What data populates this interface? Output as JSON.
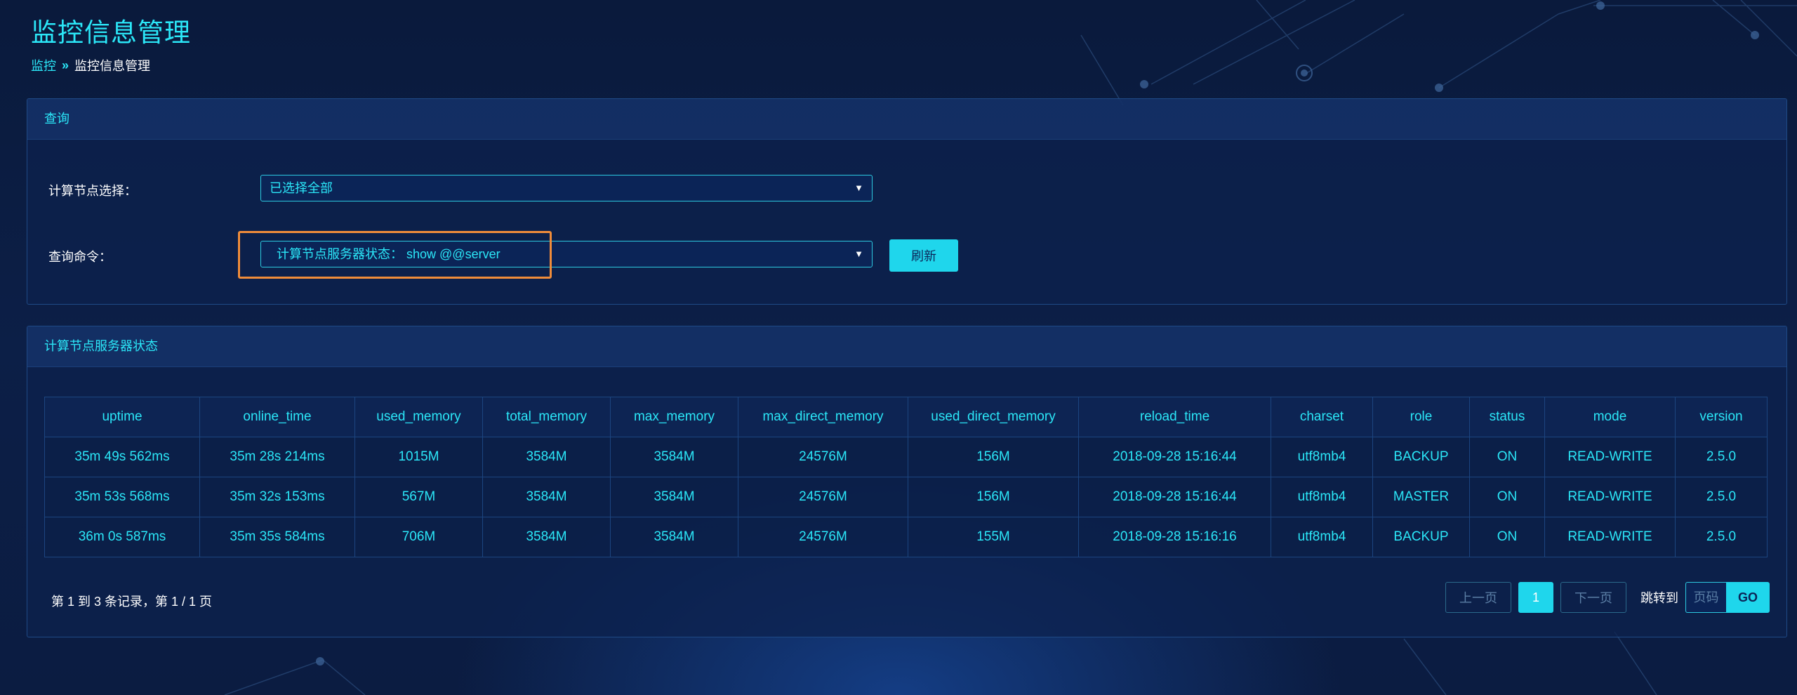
{
  "page": {
    "title": "监控信息管理"
  },
  "breadcrumb": {
    "root": "监控",
    "separator": "»",
    "current": "监控信息管理"
  },
  "query_panel": {
    "title": "查询",
    "node_label": "计算节点选择：",
    "node_value": "已选择全部",
    "command_label": "查询命令：",
    "command_value": "计算节点服务器状态：  show @@server",
    "refresh_label": "刷新"
  },
  "status_panel": {
    "title": "计算节点服务器状态",
    "columns": [
      "uptime",
      "online_time",
      "used_memory",
      "total_memory",
      "max_memory",
      "max_direct_memory",
      "used_direct_memory",
      "reload_time",
      "charset",
      "role",
      "status",
      "mode",
      "version"
    ],
    "rows": [
      [
        "35m 49s 562ms",
        "35m 28s 214ms",
        "1015M",
        "3584M",
        "3584M",
        "24576M",
        "156M",
        "2018-09-28 15:16:44",
        "utf8mb4",
        "BACKUP",
        "ON",
        "READ-WRITE",
        "2.5.0"
      ],
      [
        "35m 53s 568ms",
        "35m 32s 153ms",
        "567M",
        "3584M",
        "3584M",
        "24576M",
        "156M",
        "2018-09-28 15:16:44",
        "utf8mb4",
        "MASTER",
        "ON",
        "READ-WRITE",
        "2.5.0"
      ],
      [
        "36m 0s 587ms",
        "35m 35s 584ms",
        "706M",
        "3584M",
        "3584M",
        "24576M",
        "155M",
        "2018-09-28 15:16:16",
        "utf8mb4",
        "BACKUP",
        "ON",
        "READ-WRITE",
        "2.5.0"
      ]
    ],
    "summary": "第 1 到 3 条记录，第 1 / 1 页"
  },
  "pagination": {
    "prev": "上一页",
    "current": "1",
    "next": "下一页",
    "jump_label": "跳转到",
    "page_placeholder": "页码",
    "go": "GO"
  },
  "colors": {
    "accent": "#2be7f8",
    "button": "#1fd6ec",
    "highlight": "#f08c3a",
    "background": "#0b1c41"
  }
}
